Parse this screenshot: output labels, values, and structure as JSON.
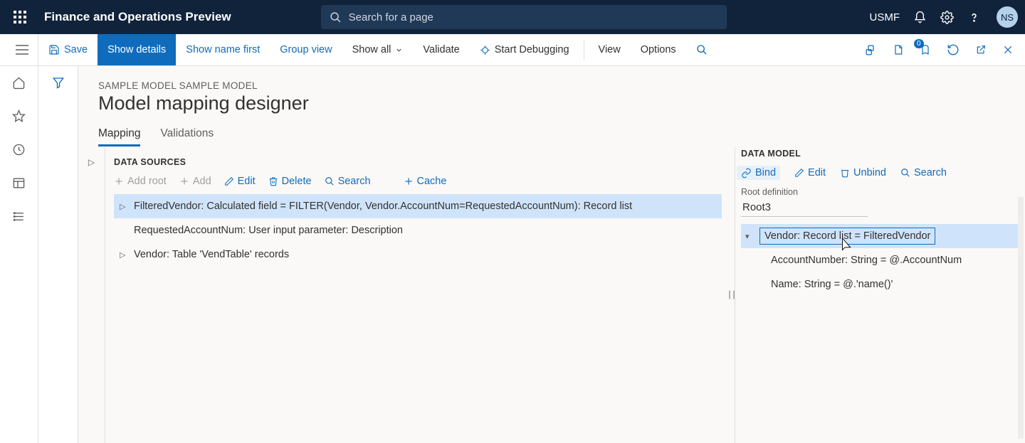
{
  "topbar": {
    "app_title": "Finance and Operations Preview",
    "search_placeholder": "Search for a page",
    "company": "USMF",
    "avatar": "NS"
  },
  "cmdbar": {
    "save": "Save",
    "show_details": "Show details",
    "show_name_first": "Show name first",
    "group_view": "Group view",
    "show_all": "Show all",
    "validate": "Validate",
    "start_debugging": "Start Debugging",
    "view": "View",
    "options": "Options",
    "badge": "0"
  },
  "page": {
    "breadcrumb": "SAMPLE MODEL SAMPLE MODEL",
    "title": "Model mapping designer",
    "tabs": {
      "mapping": "Mapping",
      "validations": "Validations"
    }
  },
  "datasources": {
    "heading": "DATA SOURCES",
    "toolbar": {
      "add_root": "Add root",
      "add": "Add",
      "edit": "Edit",
      "delete": "Delete",
      "search": "Search",
      "cache": "Cache"
    },
    "rows": [
      "FilteredVendor: Calculated field = FILTER(Vendor, Vendor.AccountNum=RequestedAccountNum): Record list",
      "RequestedAccountNum: User input parameter: Description",
      "Vendor: Table 'VendTable' records"
    ]
  },
  "datamodel": {
    "heading": "DATA MODEL",
    "toolbar": {
      "bind": "Bind",
      "edit": "Edit",
      "unbind": "Unbind",
      "search": "Search"
    },
    "rootdef_label": "Root definition",
    "rootdef_value": "Root3",
    "rows": [
      "Vendor: Record list = FilteredVendor",
      "AccountNumber: String = @.AccountNum",
      "Name: String = @.'name()'"
    ]
  }
}
